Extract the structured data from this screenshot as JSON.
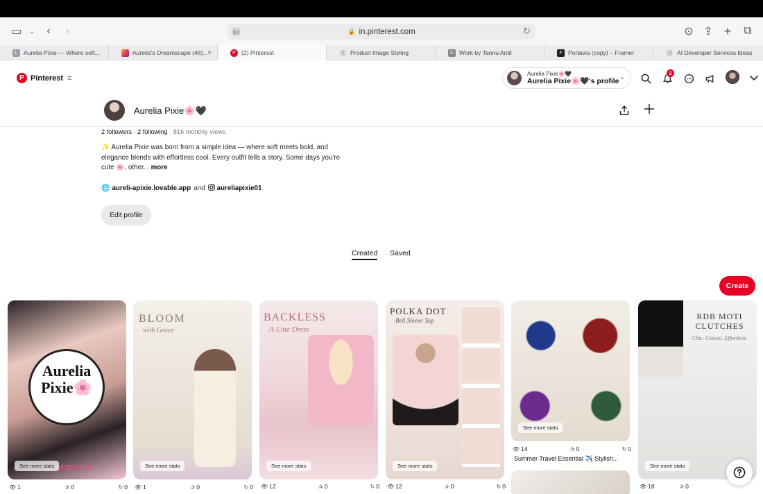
{
  "browser": {
    "url": "in.pinterest.com",
    "tabs": [
      {
        "label": "Aurelia Pixie — Where soft...",
        "fav_char": "L",
        "fav_color": "#9aa0a6"
      },
      {
        "label": "Aurelia's Dreamscape (46)...",
        "fav_char": "",
        "fav_color": "#e4405f"
      },
      {
        "label": "(2) Pinterest",
        "fav_char": "P",
        "fav_color": "#e60023"
      },
      {
        "label": "Product Image Styling",
        "fav_char": "◎",
        "fav_color": "#888888"
      },
      {
        "label": "Work by Tannu Antil",
        "fav_char": "C",
        "fav_color": "#8a8a8a"
      },
      {
        "label": "Portavia (copy) – Framer",
        "fav_char": "F",
        "fav_color": "#222222"
      },
      {
        "label": "AI Developer Services Ideas",
        "fav_char": "◎",
        "fav_color": "#888888"
      }
    ]
  },
  "header": {
    "brand": "Pinterest",
    "profile_switch_line1": "Aurelia Pixie🌸🖤",
    "profile_switch_line2": "Aurelia Pixie🌸🖤's profile",
    "notification_count": "2"
  },
  "profile": {
    "name": "Aurelia Pixie🌸🖤",
    "followers": "2 followers",
    "following": "2 following",
    "monthly_views": "816 monthly views",
    "bio": "✨ Aurelia Pixie was born from a simple idea — where soft meets bold, and elegance blends with effortless cool. Every outfit tells a story. Some days you're cute 🌸, other...",
    "bio_more": "more",
    "website": "aureli-apixie.lovable.app",
    "link_and": "and",
    "instagram": "aureliapixie01",
    "edit_label": "Edit profile"
  },
  "tabs": {
    "created": "Created",
    "saved": "Saved"
  },
  "create_label": "Create",
  "see_more_stats": "See more stats",
  "pins": [
    {
      "views": "1",
      "saves": "0",
      "clicks": "0",
      "overlay_big": "Aurelia Pixie🌸",
      "overlay_small": "CONFIDENCE"
    },
    {
      "views": "1",
      "saves": "0",
      "clicks": "0",
      "overlay_big": "BLOOM",
      "overlay_small": "with Grace"
    },
    {
      "views": "12",
      "saves": "0",
      "clicks": "0",
      "overlay_big": "BACKLESS",
      "overlay_small": "A-Line Dress"
    },
    {
      "views": "12",
      "saves": "0",
      "clicks": "0",
      "overlay_big": "POLKA DOT",
      "overlay_small": "Bell Sleeve Top"
    },
    {
      "views": "14",
      "saves": "0",
      "clicks": "0",
      "title": "Summer Travel Essential ✈️ Stylish..."
    },
    {
      "views": "18",
      "saves": "0",
      "clicks": "0",
      "overlay_big": "RDB MOTI CLUTCHES",
      "overlay_small": "Chic. Classic. Effortless."
    }
  ]
}
